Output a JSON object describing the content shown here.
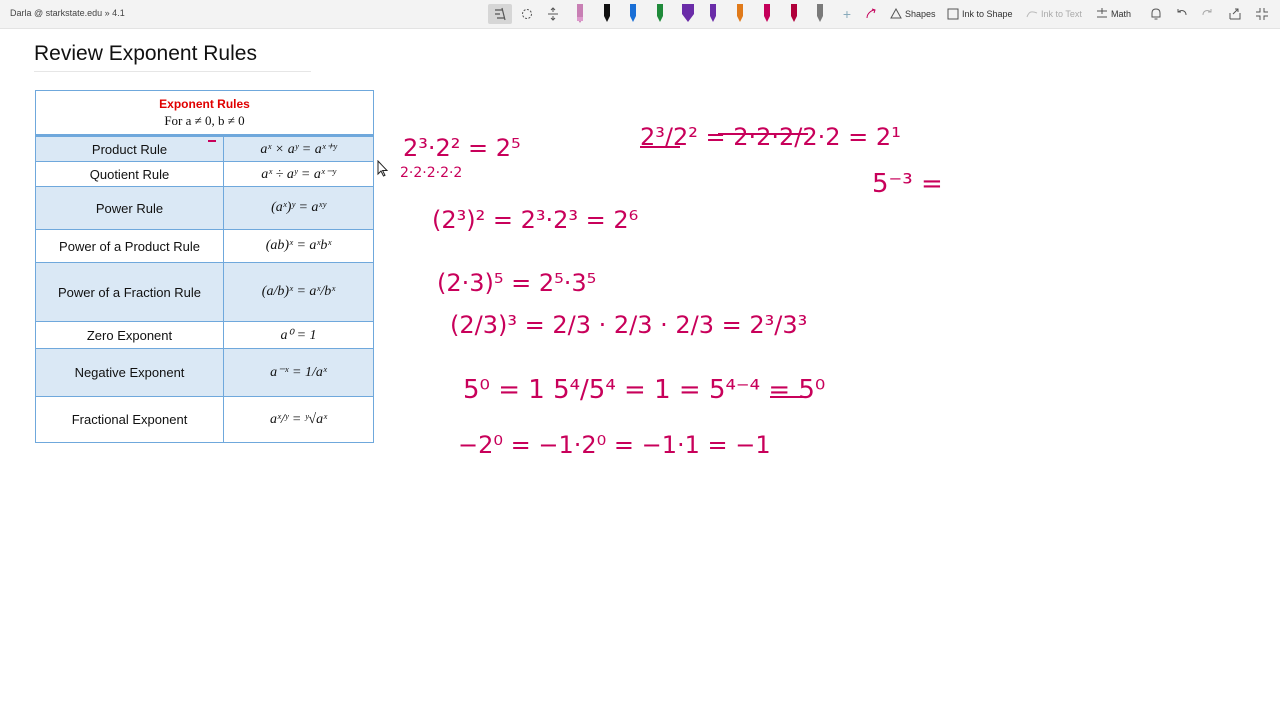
{
  "account": "Darla @ starkstate.edu » 4.1",
  "toolbar": {
    "shapes_label": "Shapes",
    "ink_to_shape_label": "Ink to Shape",
    "ink_to_text_label": "Ink to Text",
    "math_label": "Math",
    "pen_colors": [
      "#111111",
      "#111111",
      "#1a6fd6",
      "#1f8a3a",
      "#6a2ca8",
      "#6a2ca8",
      "#e07a1a",
      "#c4005a",
      "#b0003a",
      "#7a7a7a"
    ]
  },
  "page": {
    "title": "Review Exponent Rules"
  },
  "rules_table": {
    "title": "Exponent Rules",
    "subtitle": "For a ≠ 0, b ≠ 0",
    "rows": [
      {
        "name": "Product Rule",
        "formula": "aˣ × aʸ = aˣ⁺ʸ"
      },
      {
        "name": "Quotient Rule",
        "formula": "aˣ ÷ aʸ = aˣ⁻ʸ"
      },
      {
        "name": "Power Rule",
        "formula": "(aˣ)ʸ = aˣʸ"
      },
      {
        "name": "Power of a Product Rule",
        "formula": "(ab)ˣ = aˣbˣ"
      },
      {
        "name": "Power of a Fraction Rule",
        "formula": "(a/b)ˣ = aˣ/bˣ"
      },
      {
        "name": "Zero Exponent",
        "formula": "a⁰ = 1"
      },
      {
        "name": "Negative Exponent",
        "formula": "a⁻ˣ = 1/aˣ"
      },
      {
        "name": "Fractional Exponent",
        "formula": "aˣ/ʸ = ʸ√aˣ"
      }
    ]
  },
  "ink_color": "#c8005a",
  "handwriting": {
    "line1": "2³·2² = 2⁵",
    "line1_expanded": "2·2·2·2·2",
    "line2": "2³/2² = 2·2·2/2·2 = 2¹",
    "line3": "5⁻³ =",
    "line4": "(2³)² = 2³·2³ = 2⁶",
    "line5": "(2·3)⁵ = 2⁵·3⁵",
    "line6": "(2/3)³ = 2/3 · 2/3 · 2/3 = 2³/3³",
    "line7": "5⁰ = 1   5⁴/5⁴ = 1 = 5⁴⁻⁴ = 5⁰",
    "line8": "−2⁰ = −1·2⁰ = −1·1 = −1"
  }
}
